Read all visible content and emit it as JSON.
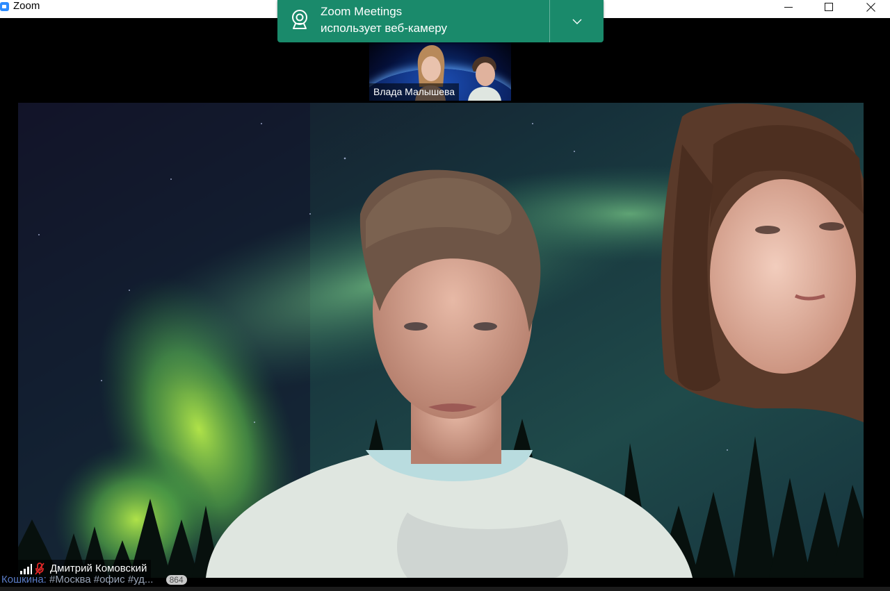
{
  "window": {
    "title": "Zoom",
    "buttons": {
      "minimize_icon": "minimize-icon",
      "maximize_icon": "maximize-icon",
      "close_icon": "close-icon"
    }
  },
  "notification": {
    "title": "Zoom Meetings",
    "subtitle": "использует веб-камеру",
    "icon": "webcam-icon",
    "expand_icon": "chevron-down-icon",
    "color": "#1a8a6b"
  },
  "thumbnail": {
    "participant_name": "Влада Малышева"
  },
  "main_video": {
    "participant_name": "Дмитрий Комовский",
    "mic_muted": true,
    "signal_icon": "signal-bars-icon",
    "mic_icon": "mic-muted-icon",
    "mic_color": "#e02828"
  },
  "background_strip": {
    "author": "Кошкина:",
    "tags": "#Москва #офис #уд...",
    "count": "864"
  }
}
